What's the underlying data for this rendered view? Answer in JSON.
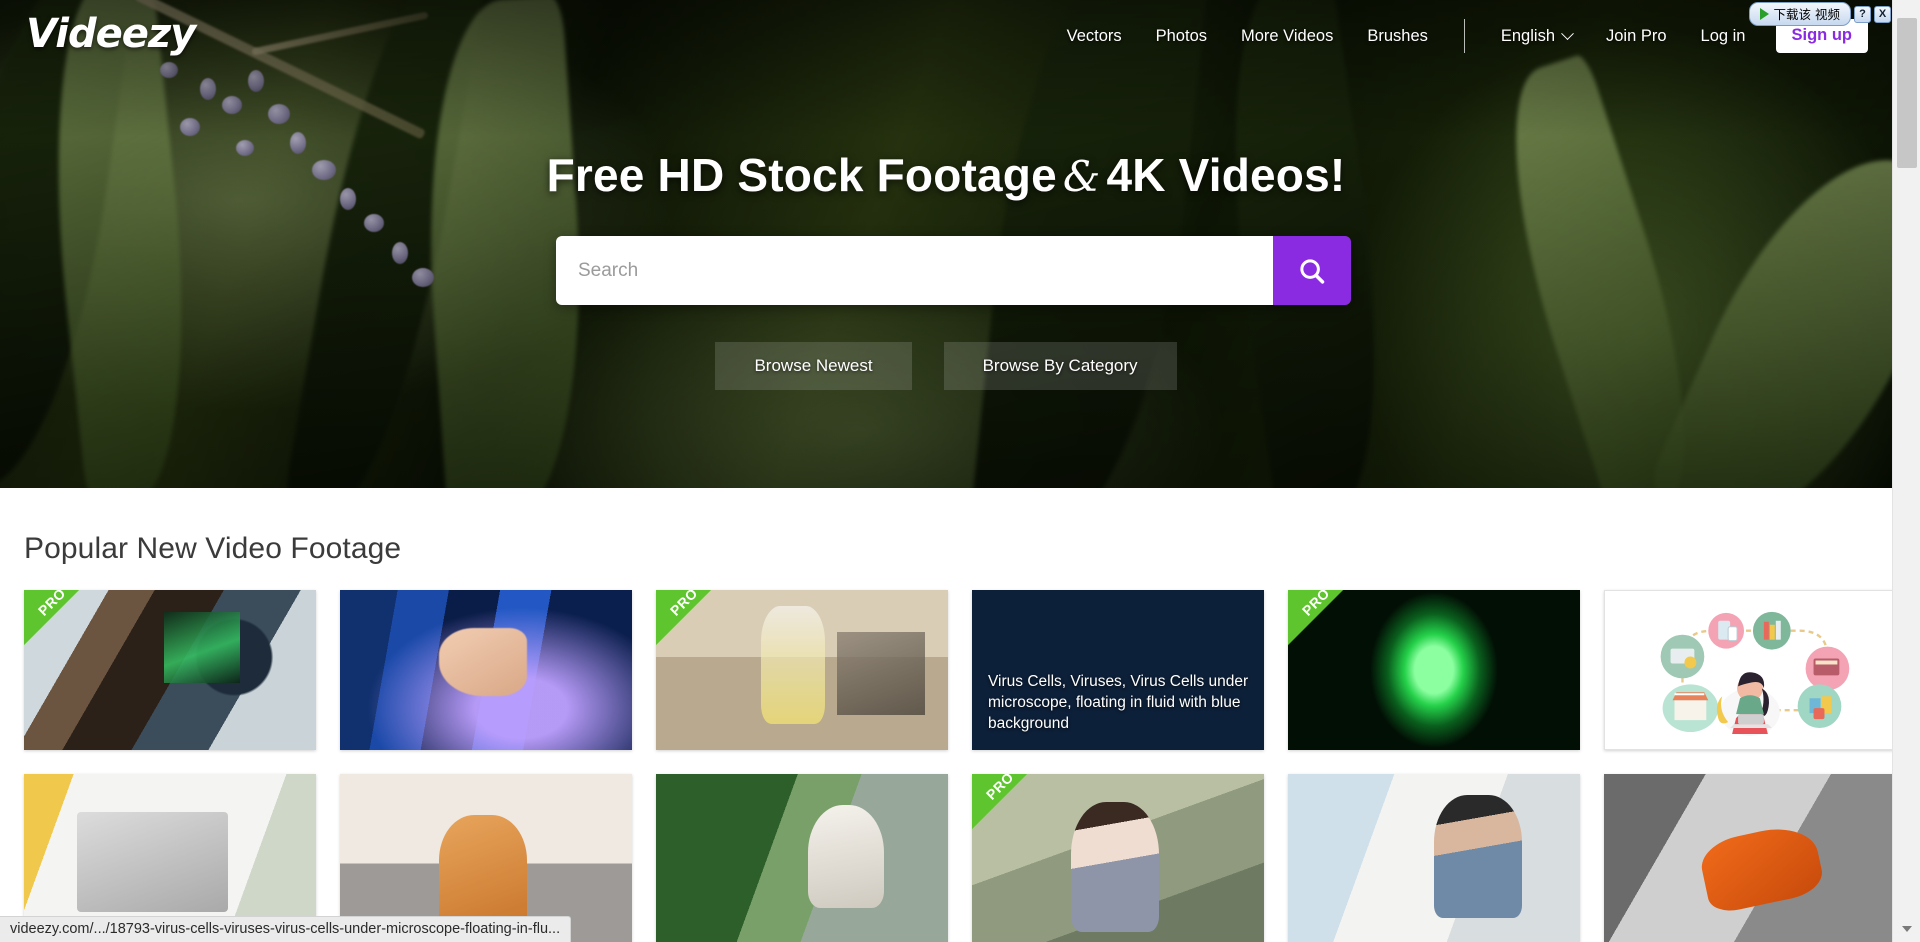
{
  "browser": {
    "extension": {
      "label": "下载该 视频",
      "play_icon": "play-icon",
      "help_label": "?",
      "close_label": "X"
    },
    "status_url": "videezy.com/.../18793-virus-cells-viruses-virus-cells-under-microscope-floating-in-flu...",
    "scrollbar": {
      "down_arrow": "▼"
    }
  },
  "header": {
    "logo": "Videezy",
    "nav": [
      {
        "label": "Vectors"
      },
      {
        "label": "Photos"
      },
      {
        "label": "More Videos"
      },
      {
        "label": "Brushes"
      }
    ],
    "language": {
      "label": "English",
      "icon": "chevron-down-icon"
    },
    "join_pro": "Join Pro",
    "log_in": "Log in",
    "sign_up": "Sign up",
    "signup_color": "#8A2BE2"
  },
  "hero": {
    "title_part1": "Free HD Stock Footage",
    "title_amp": "&",
    "title_part2": "4K Videos!",
    "search": {
      "value": "",
      "placeholder": "Search",
      "button_icon": "search-icon",
      "button_color": "#8A2BE2"
    },
    "browse_newest": "Browse Newest",
    "browse_by_category": "Browse By Category"
  },
  "main": {
    "section_title": "Popular New Video Footage",
    "pro_badge": "PRO",
    "pro_color": "#5FC52E",
    "rows": [
      {
        "cards": [
          {
            "art": "t-microscope",
            "name": "card-scientist-microscope",
            "pro": true,
            "title": ""
          },
          {
            "art": "t-pipette",
            "name": "card-lab-pipette",
            "pro": false,
            "title": ""
          },
          {
            "art": "t-flask",
            "name": "card-lab-flasks",
            "pro": true,
            "title": ""
          },
          {
            "art": "t-virus",
            "name": "card-virus-cells",
            "pro": false,
            "title": "Virus Cells, Viruses, Virus Cells under microscope, floating in fluid with blue background"
          },
          {
            "art": "t-cell",
            "name": "card-green-cell",
            "pro": true,
            "title": ""
          },
          {
            "art": "t-illus",
            "name": "card-ecommerce-illustration",
            "pro": false,
            "title": ""
          }
        ]
      },
      {
        "cards": [
          {
            "art": "t-laptop",
            "name": "card-hands-laptop",
            "pro": false,
            "title": ""
          },
          {
            "art": "t-couch",
            "name": "card-man-couch-phone",
            "pro": false,
            "title": ""
          },
          {
            "art": "t-coffee",
            "name": "card-woman-coffee",
            "pro": false,
            "title": ""
          },
          {
            "art": "t-mask",
            "name": "card-woman-mask-thumbsup",
            "pro": true,
            "title": ""
          },
          {
            "art": "t-tired",
            "name": "card-man-tired-desk",
            "pro": false,
            "title": ""
          },
          {
            "art": "t-glove",
            "name": "card-glove-cleaning",
            "pro": false,
            "title": ""
          }
        ]
      }
    ]
  }
}
